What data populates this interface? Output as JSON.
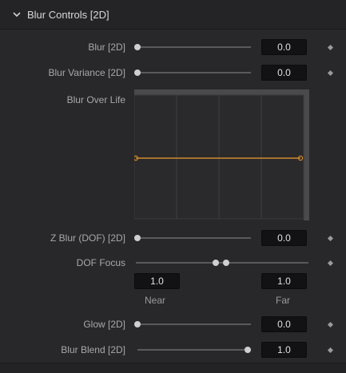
{
  "section": {
    "title": "Blur Controls [2D]"
  },
  "controls": {
    "blur": {
      "label": "Blur [2D]",
      "value": "0.0",
      "level": 0.0
    },
    "blur_variance": {
      "label": "Blur Variance [2D]",
      "value": "0.0",
      "level": 0.0
    },
    "blur_over_life": {
      "label": "Blur Over Life"
    },
    "z_blur": {
      "label": "Z Blur (DOF) [2D]",
      "value": "0.0",
      "level": 0.0
    },
    "dof_focus": {
      "label": "DOF Focus",
      "near_value": "1.0",
      "far_value": "1.0",
      "near_label": "Near",
      "far_label": "Far"
    },
    "glow": {
      "label": "Glow [2D]",
      "value": "0.0",
      "level": 0.0
    },
    "blur_blend": {
      "label": "Blur Blend [2D]",
      "value": "1.0",
      "level": 1.0
    }
  },
  "colors": {
    "panel_bg": "#28282a",
    "curve_line": "#d08a2c",
    "track": "#5a5a5c",
    "knob": "#cfcfcf"
  }
}
